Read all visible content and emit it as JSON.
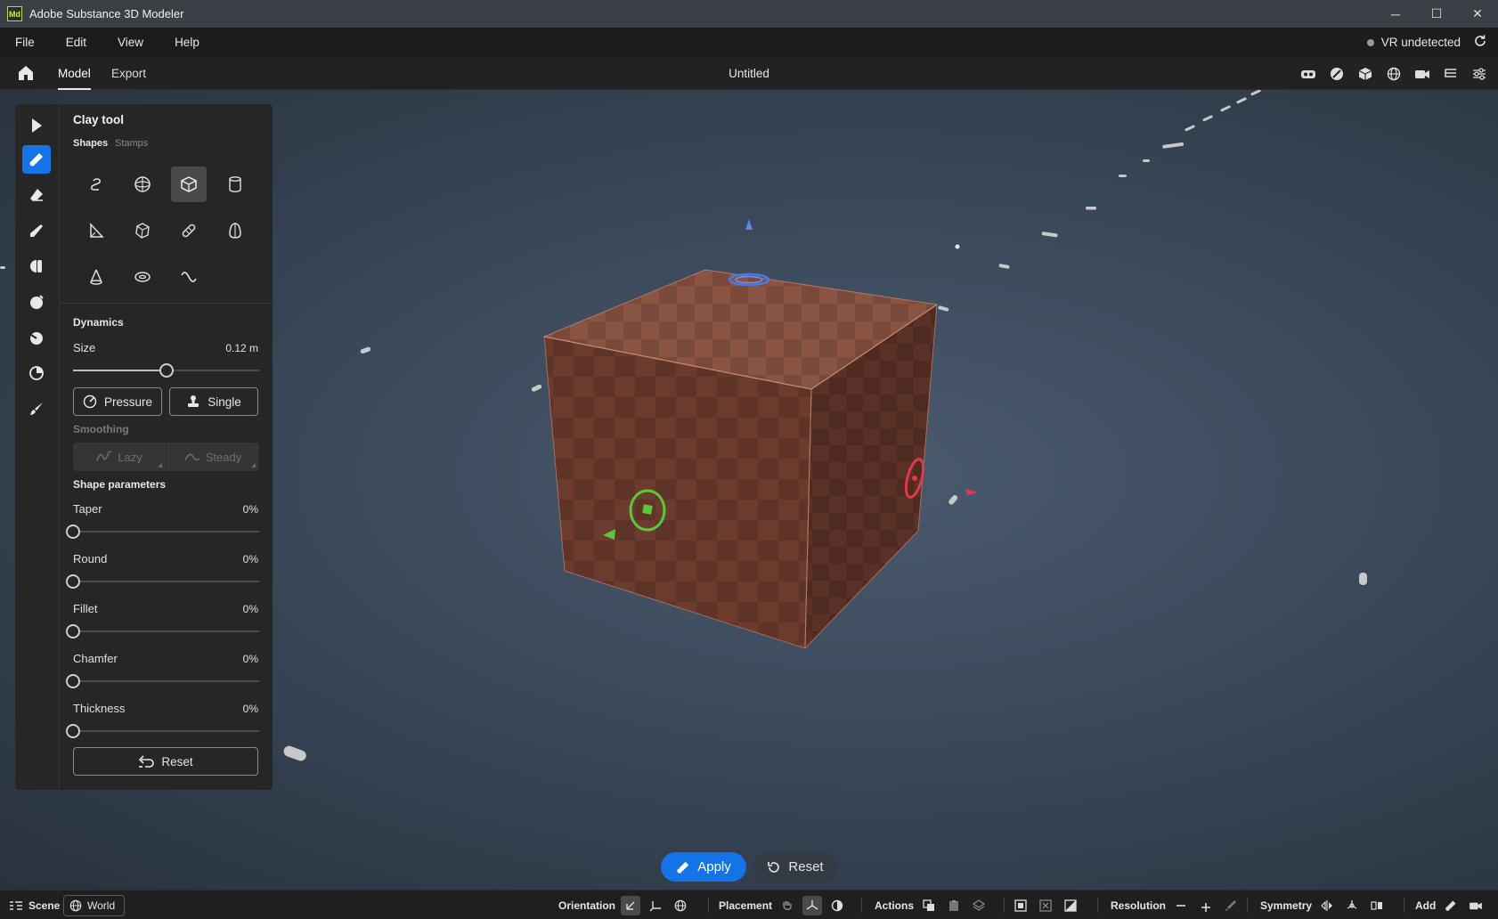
{
  "window": {
    "app_badge": "Md",
    "title": "Adobe Substance 3D Modeler",
    "controls": {
      "minimize": "─",
      "maximize": "☐",
      "close": "✕"
    }
  },
  "menu": {
    "items": [
      "File",
      "Edit",
      "View",
      "Help"
    ],
    "vr_status": "VR undetected"
  },
  "header": {
    "tabs": [
      "Model",
      "Export"
    ],
    "active_tab": "Model",
    "document_title": "Untitled"
  },
  "panel": {
    "title": "Clay tool",
    "subtabs": [
      "Shapes",
      "Stamps"
    ],
    "active_subtab": "Shapes",
    "dynamics": {
      "title": "Dynamics",
      "size_label": "Size",
      "size_value": "0.12 m",
      "size_fraction": 0.5,
      "pressure_label": "Pressure",
      "single_label": "Single"
    },
    "smoothing": {
      "title": "Smoothing",
      "lazy_label": "Lazy",
      "steady_label": "Steady"
    },
    "shape_parameters": {
      "title": "Shape parameters",
      "params": [
        {
          "label": "Taper",
          "value": "0%",
          "fraction": 0
        },
        {
          "label": "Round",
          "value": "0%",
          "fraction": 0
        },
        {
          "label": "Fillet",
          "value": "0%",
          "fraction": 0
        },
        {
          "label": "Chamfer",
          "value": "0%",
          "fraction": 0
        },
        {
          "label": "Thickness",
          "value": "0%",
          "fraction": 0
        }
      ],
      "reset_label": "Reset"
    }
  },
  "viewport": {
    "apply_label": "Apply",
    "reset_label": "Reset",
    "colors": {
      "accent": "#1473e6",
      "cube": "#7a4a3a",
      "gizmo_x": "#e03a4a",
      "gizmo_y": "#5ac83a",
      "gizmo_z": "#4a78e8"
    }
  },
  "bottom": {
    "scene_label": "Scene",
    "world_label": "World",
    "orientation_label": "Orientation",
    "placement_label": "Placement",
    "actions_label": "Actions",
    "resolution_label": "Resolution",
    "symmetry_label": "Symmetry",
    "add_label": "Add"
  }
}
